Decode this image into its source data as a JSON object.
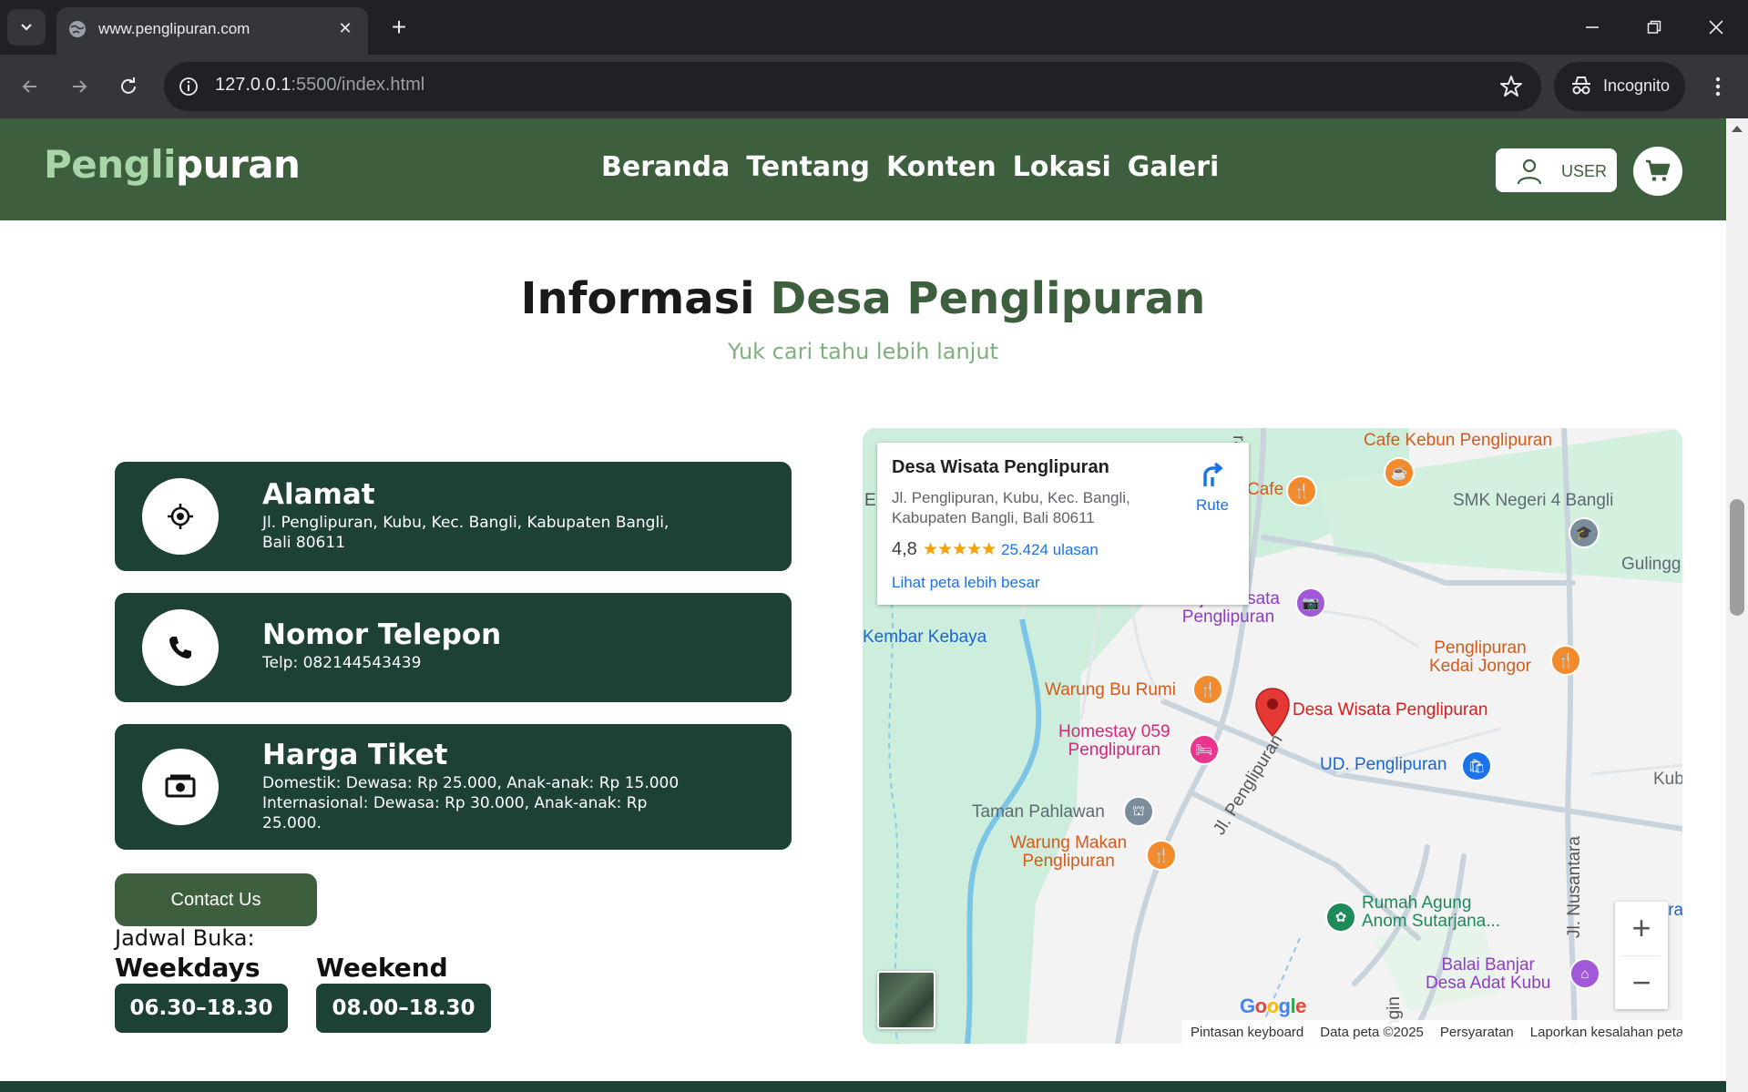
{
  "browser": {
    "tab_title": "www.penglipuran.com",
    "url_host": "127.0.0.1",
    "url_rest": ":5500/index.html",
    "incognito_label": "Incognito"
  },
  "site": {
    "logo_part1": "Pengli",
    "logo_part2": "puran",
    "nav": [
      "Beranda",
      "Tentang",
      "Konten",
      "Lokasi",
      "Galeri"
    ],
    "user_label": "USER",
    "accent": "#3e5f3d",
    "card_color": "#1d4037"
  },
  "section": {
    "title_main": "Informasi",
    "title_accent": "Desa Penglipuran",
    "subtitle": "Yuk cari tahu lebih lanjut"
  },
  "cards": [
    {
      "title": "Alamat",
      "text": "Jl. Penglipuran, Kubu, Kec. Bangli, Kabupaten Bangli, Bali 80611",
      "icon": "location-target-icon"
    },
    {
      "title": "Nomor Telepon",
      "text": "Telp: 082144543439",
      "icon": "phone-icon"
    },
    {
      "title": "Harga Tiket",
      "text": "Domestik: Dewasa: Rp 25.000, Anak-anak: Rp 15.000 Internasional: Dewasa: Rp 30.000, Anak-anak: Rp 25.000.",
      "icon": "money-icon"
    }
  ],
  "contact_button": "Contact Us",
  "schedule": {
    "label": "Jadwal Buka:",
    "weekdays_label": "Weekdays",
    "weekdays_time": "06.30–18.30",
    "weekend_label": "Weekend",
    "weekend_time": "08.00–18.30"
  },
  "map": {
    "place_name": "Desa Wisata Penglipuran",
    "address": "Jl. Penglipuran, Kubu, Kec. Bangli, Kabupaten Bangli, Bali 80611",
    "rating": "4,8",
    "stars": "★★★★★",
    "reviews": "25.424 ulasan",
    "larger_map": "Lihat peta lebih besar",
    "route_label": "Rute",
    "labels": {
      "cafe_kebun": "Cafe Kebun Penglipuran",
      "cafe": "Cafe",
      "smk": "SMK Negeri 4 Bangli",
      "gulingan": "Gulingg",
      "obyek_1": "Objek Wisata",
      "obyek_2": "Penglipuran",
      "kembar": "Kembar Kebaya",
      "kedai_1": "Penglipuran",
      "kedai_2": "Kedai Jongor",
      "warung_bu_rumi": "Warung Bu Rumi",
      "desa_wisata": "Desa Wisata Penglipuran",
      "homestay_1": "Homestay 059",
      "homestay_2": "Penglipuran",
      "ud": "UD. Penglipuran",
      "kub": "Kub",
      "taman": "Taman Pahlawan",
      "jl_penglipuran": "Jl. Penglipuran",
      "warung_makan_1": "Warung Makan",
      "warung_makan_2": "Penglipuran",
      "rumah_agung_1": "Rumah Agung",
      "rumah_agung_2": "Anom Sutarjana...",
      "jl_nusantara": "Jl. Nusantara",
      "balai_1": "Balai Banjar",
      "balai_2": "Desa Adat Kubu",
      "rasti": "rasti",
      "edge_e": "E",
      "edge_ngin": "ngin",
      "edge_ira": "ira"
    },
    "attribution": [
      "Pintasan keyboard",
      "Data peta ©2025",
      "Persyaratan",
      "Laporkan kesalahan peta"
    ]
  }
}
